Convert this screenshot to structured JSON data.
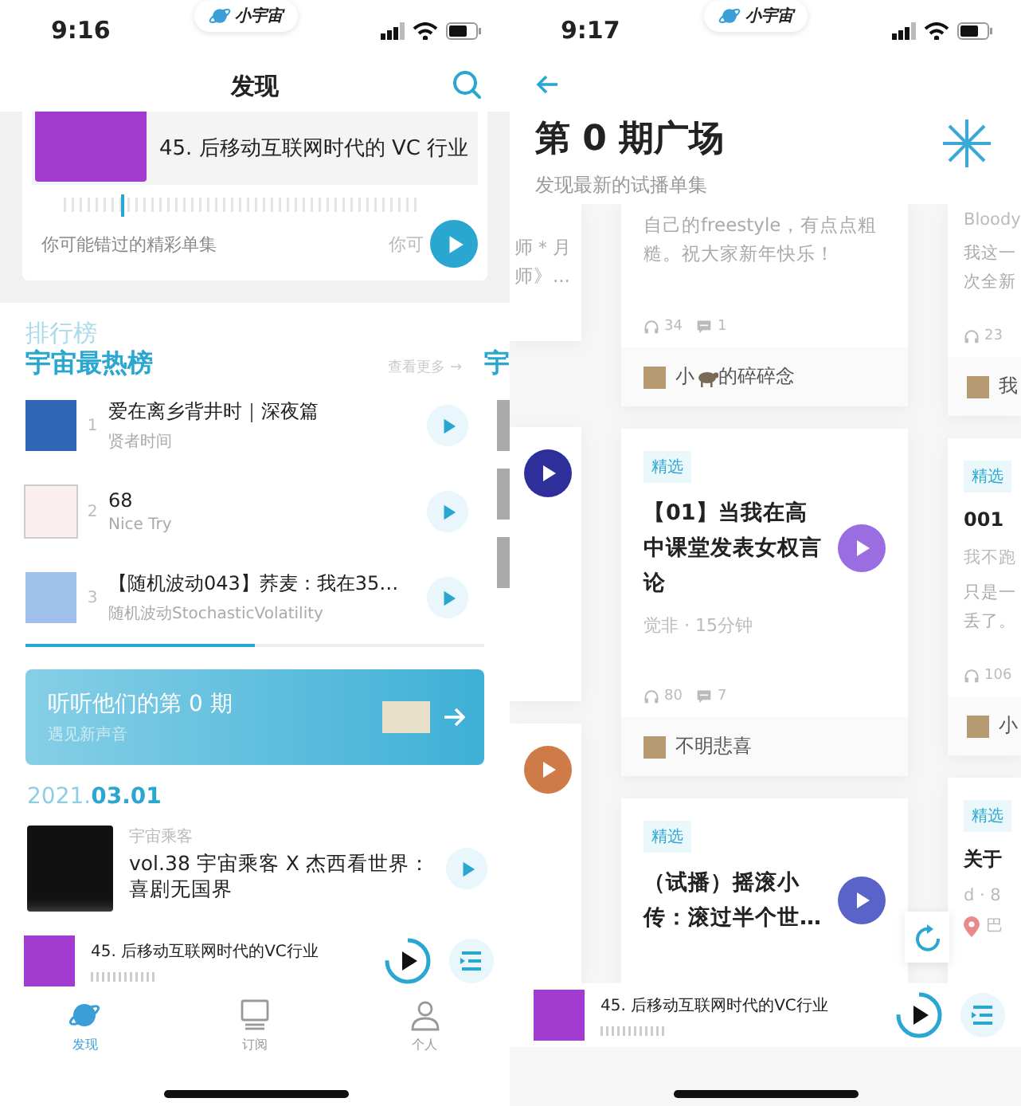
{
  "left_screen": {
    "status_bar": {
      "time": "9:16",
      "app_pill": "小宇宙"
    },
    "header": {
      "title": "发现"
    },
    "featured": {
      "episode_title": "45. 后移动互联网时代的 VC 行业",
      "caption": "你可能错过的精彩单集",
      "next_caption": "你可"
    },
    "ranking": {
      "eyebrow": "排行榜",
      "title": "宇宙最热榜",
      "more": "查看更多 →",
      "next_title": "宇",
      "items": [
        {
          "rank": "1",
          "title": "爱在离乡背井时｜深夜篇",
          "podcast": "贤者时间"
        },
        {
          "rank": "2",
          "title": "68",
          "podcast": "Nice Try"
        },
        {
          "rank": "3",
          "title": "【随机波动043】荞麦：我在35…",
          "podcast": "随机波动StochasticVolatility"
        }
      ]
    },
    "banner": {
      "title": "听听他们的第 0 期",
      "subtitle": "遇见新声音"
    },
    "date": {
      "year": "2021.",
      "day": "03.01"
    },
    "episode": {
      "podcast": "宇宙乘客",
      "title": "vol.38 宇宙乘客 X 杰西看世界：喜剧无国界"
    },
    "mini_player": {
      "title": "45. 后移动互联网时代的VC行业",
      "level": 0.75
    },
    "tabs": [
      {
        "label": "发现",
        "selected": true
      },
      {
        "label": "订阅",
        "selected": false
      },
      {
        "label": "个人",
        "selected": false
      }
    ]
  },
  "right_screen": {
    "status_bar": {
      "time": "9:17",
      "app_pill": "小宇宙"
    },
    "header": {
      "title": "第 0 期广场",
      "subtitle": "发现最新的试播单集"
    },
    "columns": [
      {
        "cards": [
          {
            "lines": [
              "师＊月",
              "师》..."
            ]
          },
          {
            "color": "#2e2f9a"
          },
          {
            "color": "#cf7b48"
          }
        ]
      },
      {
        "cards": [
          {
            "lines": [
              "自己的freestyle，有点点粗",
              "糙。祝大家新年快乐！"
            ],
            "listens": "34",
            "comments": "1",
            "author_parts": [
              "小",
              "的碎碎念"
            ]
          },
          {
            "tag": "精选",
            "title": "【01】当我在高中课堂发表女权言论",
            "color": "#9a6ee0",
            "meta": "觉非 · 15分钟",
            "listens": "80",
            "comments": "7",
            "author": "不明悲喜"
          },
          {
            "tag": "精选",
            "title": "（试播）摇滚小传：滚过半个世…",
            "color": "#5a64c8"
          }
        ]
      },
      {
        "cards": [
          {
            "meta": "Bloody",
            "lines": [
              "我这一",
              "次全新"
            ],
            "listens": "23",
            "author": "我"
          },
          {
            "tag": "精选",
            "title": "001",
            "meta": "我不跑",
            "lines": [
              "只是一",
              "丢了。"
            ],
            "listens": "106",
            "author": "小"
          },
          {
            "tag": "精选",
            "title": "关于",
            "meta": "d · 8",
            "location": "巴"
          }
        ]
      }
    ],
    "mini_player": {
      "title": "45. 后移动互联网时代的VC行业",
      "level": 0.75
    }
  }
}
